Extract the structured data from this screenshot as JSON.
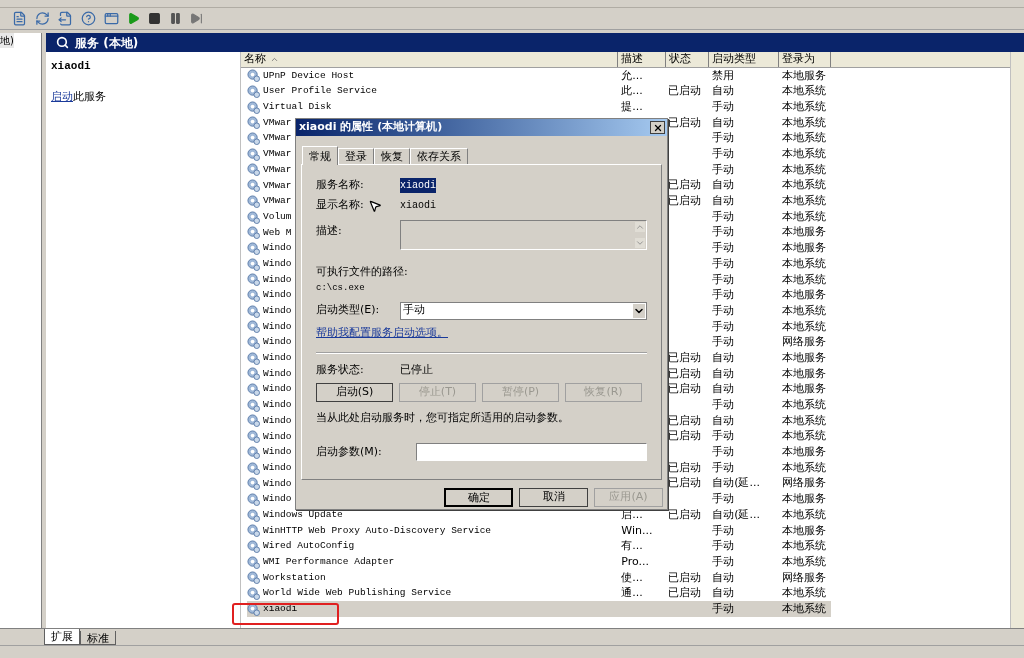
{
  "tree": {
    "items": [
      {
        "label": "地)"
      }
    ]
  },
  "panel": {
    "title": "服务 (本地)",
    "selected_service": "xiaodi",
    "action_link": "启动",
    "action_rest": "此服务"
  },
  "table": {
    "columns": [
      "名称",
      "描述",
      "状态",
      "启动类型",
      "登录为"
    ],
    "rows": [
      {
        "name": "UPnP Device Host",
        "description": "允...",
        "status": "",
        "startup_type": "禁用",
        "log_on_as": "本地服务",
        "selected": false
      },
      {
        "name": "User Profile Service",
        "description": "此...",
        "status": "已启动",
        "startup_type": "自动",
        "log_on_as": "本地系统",
        "selected": false
      },
      {
        "name": "Virtual Disk",
        "description": "提...",
        "status": "",
        "startup_type": "手动",
        "log_on_as": "本地系统",
        "selected": false
      },
      {
        "name": "VMwar",
        "description": "",
        "status": "已启动",
        "startup_type": "自动",
        "log_on_as": "本地系统",
        "selected": false
      },
      {
        "name": "VMwar",
        "description": "",
        "status": "",
        "startup_type": "手动",
        "log_on_as": "本地系统",
        "selected": false
      },
      {
        "name": "VMwar",
        "description": "",
        "status": "",
        "startup_type": "手动",
        "log_on_as": "本地系统",
        "selected": false
      },
      {
        "name": "VMwar",
        "description": "",
        "status": "",
        "startup_type": "手动",
        "log_on_as": "本地系统",
        "selected": false
      },
      {
        "name": "VMwar",
        "description": "",
        "status": "已启动",
        "startup_type": "自动",
        "log_on_as": "本地系统",
        "selected": false
      },
      {
        "name": "VMwar",
        "description": "",
        "status": "已启动",
        "startup_type": "自动",
        "log_on_as": "本地系统",
        "selected": false
      },
      {
        "name": "Volum",
        "description": "",
        "status": "",
        "startup_type": "手动",
        "log_on_as": "本地系统",
        "selected": false
      },
      {
        "name": "Web M",
        "description": "",
        "status": "",
        "startup_type": "手动",
        "log_on_as": "本地服务",
        "selected": false
      },
      {
        "name": "Windo",
        "description": "",
        "status": "",
        "startup_type": "手动",
        "log_on_as": "本地服务",
        "selected": false
      },
      {
        "name": "Windo",
        "description": "",
        "status": "",
        "startup_type": "手动",
        "log_on_as": "本地系统",
        "selected": false
      },
      {
        "name": "Windo",
        "description": "",
        "status": "",
        "startup_type": "手动",
        "log_on_as": "本地系统",
        "selected": false
      },
      {
        "name": "Windo",
        "description": "",
        "status": "",
        "startup_type": "手动",
        "log_on_as": "本地服务",
        "selected": false
      },
      {
        "name": "Windo",
        "description": "",
        "status": "",
        "startup_type": "手动",
        "log_on_as": "本地系统",
        "selected": false
      },
      {
        "name": "Windo",
        "description": "",
        "status": "",
        "startup_type": "手动",
        "log_on_as": "本地系统",
        "selected": false
      },
      {
        "name": "Windo",
        "description": "",
        "status": "",
        "startup_type": "手动",
        "log_on_as": "网络服务",
        "selected": false
      },
      {
        "name": "Windo",
        "description": "",
        "status": "已启动",
        "startup_type": "自动",
        "log_on_as": "本地服务",
        "selected": false
      },
      {
        "name": "Windo",
        "description": "",
        "status": "已启动",
        "startup_type": "自动",
        "log_on_as": "本地服务",
        "selected": false
      },
      {
        "name": "Windo",
        "description": "",
        "status": "已启动",
        "startup_type": "自动",
        "log_on_as": "本地服务",
        "selected": false
      },
      {
        "name": "Windo",
        "description": "",
        "status": "",
        "startup_type": "手动",
        "log_on_as": "本地系统",
        "selected": false
      },
      {
        "name": "Windo",
        "description": "",
        "status": "已启动",
        "startup_type": "自动",
        "log_on_as": "本地系统",
        "selected": false
      },
      {
        "name": "Windo",
        "description": "",
        "status": "已启动",
        "startup_type": "手动",
        "log_on_as": "本地系统",
        "selected": false
      },
      {
        "name": "Windo",
        "description": "",
        "status": "",
        "startup_type": "手动",
        "log_on_as": "本地服务",
        "selected": false
      },
      {
        "name": "Windo",
        "description": "",
        "status": "已启动",
        "startup_type": "手动",
        "log_on_as": "本地系统",
        "selected": false
      },
      {
        "name": "Windo",
        "description": "",
        "status": "已启动",
        "startup_type": "自动(延...",
        "log_on_as": "网络服务",
        "selected": false
      },
      {
        "name": "Windo",
        "description": "",
        "status": "",
        "startup_type": "手动",
        "log_on_as": "本地服务",
        "selected": false
      },
      {
        "name": "Windows Update",
        "description": "启...",
        "status": "已启动",
        "startup_type": "自动(延...",
        "log_on_as": "本地系统",
        "selected": false
      },
      {
        "name": "WinHTTP Web Proxy Auto-Discovery Service",
        "description": "Win...",
        "status": "",
        "startup_type": "手动",
        "log_on_as": "本地服务",
        "selected": false
      },
      {
        "name": "Wired AutoConfig",
        "description": "有...",
        "status": "",
        "startup_type": "手动",
        "log_on_as": "本地系统",
        "selected": false
      },
      {
        "name": "WMI Performance Adapter",
        "description": "Pro...",
        "status": "",
        "startup_type": "手动",
        "log_on_as": "本地系统",
        "selected": false
      },
      {
        "name": "Workstation",
        "description": "使...",
        "status": "已启动",
        "startup_type": "自动",
        "log_on_as": "网络服务",
        "selected": false
      },
      {
        "name": "World Wide Web Publishing Service",
        "description": "通...",
        "status": "已启动",
        "startup_type": "自动",
        "log_on_as": "本地系统",
        "selected": false
      },
      {
        "name": "xiaodi",
        "description": "",
        "status": "",
        "startup_type": "手动",
        "log_on_as": "本地系统",
        "selected": true
      }
    ]
  },
  "dialog": {
    "title": "xiaodi 的属性 (本地计算机)",
    "tabs": [
      {
        "label": "常规",
        "selected": true
      },
      {
        "label": "登录",
        "selected": false
      },
      {
        "label": "恢复",
        "selected": false
      },
      {
        "label": "依存关系",
        "selected": false
      }
    ],
    "service_name": {
      "label": "服务名称:",
      "value": "xiaodi",
      "text_selected": true
    },
    "display_name": {
      "label": "显示名称:",
      "value": "xiaodi"
    },
    "description": {
      "label": "描述:"
    },
    "path": {
      "label": "可执行文件的路径:",
      "value": "c:\\cs.exe"
    },
    "startup_type": {
      "label": "启动类型(E):",
      "value": "手动"
    },
    "help_link": "帮助我配置服务启动选项。",
    "service_status": {
      "label": "服务状态:",
      "value": "已停止"
    },
    "control_buttons": [
      {
        "label": "启动(S)",
        "disabled": false
      },
      {
        "label": "停止(T)",
        "disabled": true
      },
      {
        "label": "暂停(P)",
        "disabled": true
      },
      {
        "label": "恢复(R)",
        "disabled": true
      }
    ],
    "hint": "当从此处启动服务时，您可指定所适用的启动参数。",
    "start_parameters": {
      "label": "启动参数(M):"
    },
    "buttons": [
      {
        "label": "确定",
        "disabled": false,
        "default": true
      },
      {
        "label": "取消",
        "disabled": false,
        "default": false
      },
      {
        "label": "应用(A)",
        "disabled": true,
        "default": false
      }
    ]
  },
  "bottom_tabs": [
    {
      "label": "扩展",
      "selected": true
    },
    {
      "label": "标准",
      "selected": false
    }
  ]
}
